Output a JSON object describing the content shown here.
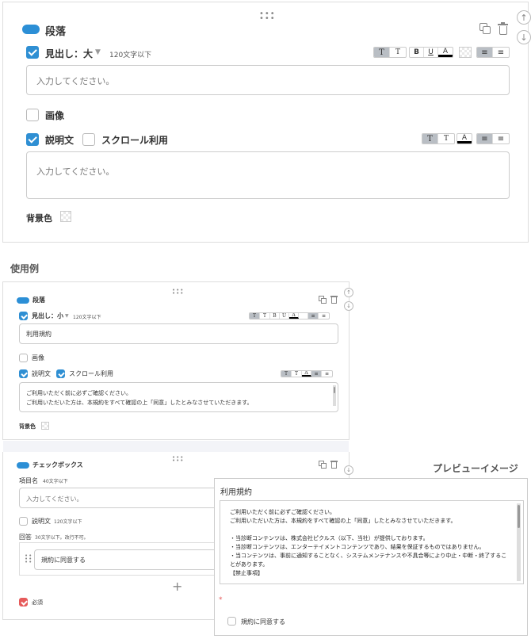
{
  "top_editor": {
    "section_label": "段落",
    "heading_label": "見出し：大",
    "heading_limit": "120文字以下",
    "input_placeholder": "入力してください。",
    "image_label": "画像",
    "description_label": "説明文",
    "scroll_label": "スクロール利用",
    "textarea_placeholder": "入力してください。",
    "bg_color_label": "背景色",
    "toolbar_heading": [
      "T",
      "T",
      "B",
      "U",
      "A",
      "",
      "≡",
      "≡"
    ],
    "toolbar_desc": [
      "T",
      "T",
      "A",
      "≡",
      "≡"
    ]
  },
  "usage": {
    "title": "使用例",
    "editor1": {
      "section_label": "段落",
      "heading_label": "見出し：小",
      "heading_limit": "120文字以下",
      "heading_value": "利用規約",
      "image_label": "画像",
      "description_label": "説明文",
      "scroll_label": "スクロール利用",
      "textarea_line1": "ご利用いただく前に必ずご確認ください。",
      "textarea_line2": "ご利用いただいた方は、本規約をすべて確認の上「同意」したとみなさせていただきます。",
      "bg_color_label": "背景色"
    },
    "editor2": {
      "section_label": "チェックボックス",
      "item_name_label": "項目名",
      "item_name_limit": "40文字以下",
      "input_placeholder": "入力してください。",
      "description_label": "説明文",
      "description_limit": "120文字以下",
      "answer_label": "回答",
      "answer_limit": "30文字以下。改行不可。",
      "answer_value": "規約に同意する",
      "add_symbol": "+",
      "required_label": "必須"
    }
  },
  "preview": {
    "title": "プレビューイメージ",
    "heading": "利用規約",
    "lines": [
      "ご利用いただく前に必ずご確認ください。",
      "ご利用いただいた方は、本規約をすべて確認の上「同意」したとみなさせていただきます。",
      "",
      "・当診断コンテンツは、株式会社ピクルス（以下、当社）が提供しております。",
      "・当診断コンテンツは、エンターテイメントコンテンツであり、結果を保証するものではありません。",
      "・当コンテンツは、事前に通知することなく、システムメンテナンスや不具合等により中止・中断・終了することがあります。",
      "【禁止事項】"
    ],
    "required_mark": "*",
    "agree_label": "規約に同意する"
  }
}
